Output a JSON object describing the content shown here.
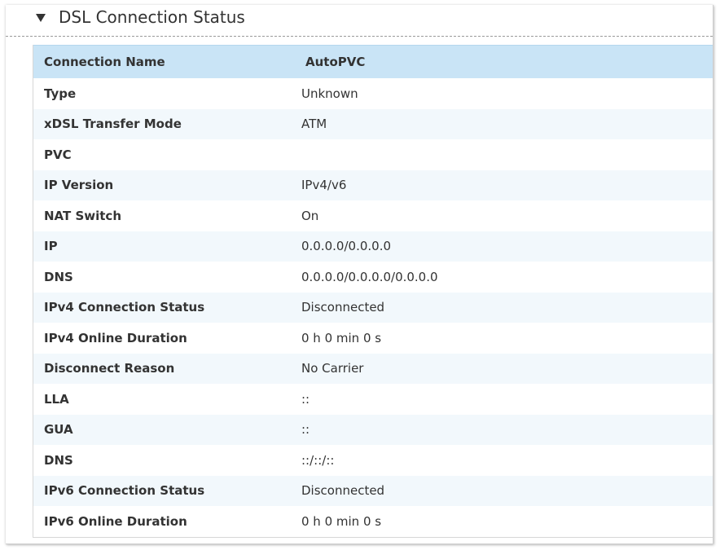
{
  "section": {
    "title": "DSL Connection Status",
    "toggle_icon": "triangle-down-icon"
  },
  "table": {
    "header": {
      "label": "Connection Name",
      "value": "AutoPVC"
    },
    "rows": [
      {
        "label": "Type",
        "value": "Unknown"
      },
      {
        "label": "xDSL Transfer Mode",
        "value": "ATM"
      },
      {
        "label": "PVC",
        "value": ""
      },
      {
        "label": "IP Version",
        "value": "IPv4/v6"
      },
      {
        "label": "NAT Switch",
        "value": "On"
      },
      {
        "label": "IP",
        "value": "0.0.0.0/0.0.0.0"
      },
      {
        "label": "DNS",
        "value": "0.0.0.0/0.0.0.0/0.0.0.0"
      },
      {
        "label": "IPv4 Connection Status",
        "value": "Disconnected"
      },
      {
        "label": "IPv4 Online Duration",
        "value": "0 h 0 min 0 s"
      },
      {
        "label": "Disconnect Reason",
        "value": "No Carrier"
      },
      {
        "label": "LLA",
        "value": "::"
      },
      {
        "label": "GUA",
        "value": "::"
      },
      {
        "label": "DNS",
        "value": "::/::/::"
      },
      {
        "label": "IPv6 Connection Status",
        "value": "Disconnected"
      },
      {
        "label": "IPv6 Online Duration",
        "value": "0 h 0 min 0 s"
      }
    ]
  },
  "colors": {
    "header_bg": "#c9e4f6",
    "alt_row_bg": "#f2f8fc",
    "text": "#333333"
  }
}
